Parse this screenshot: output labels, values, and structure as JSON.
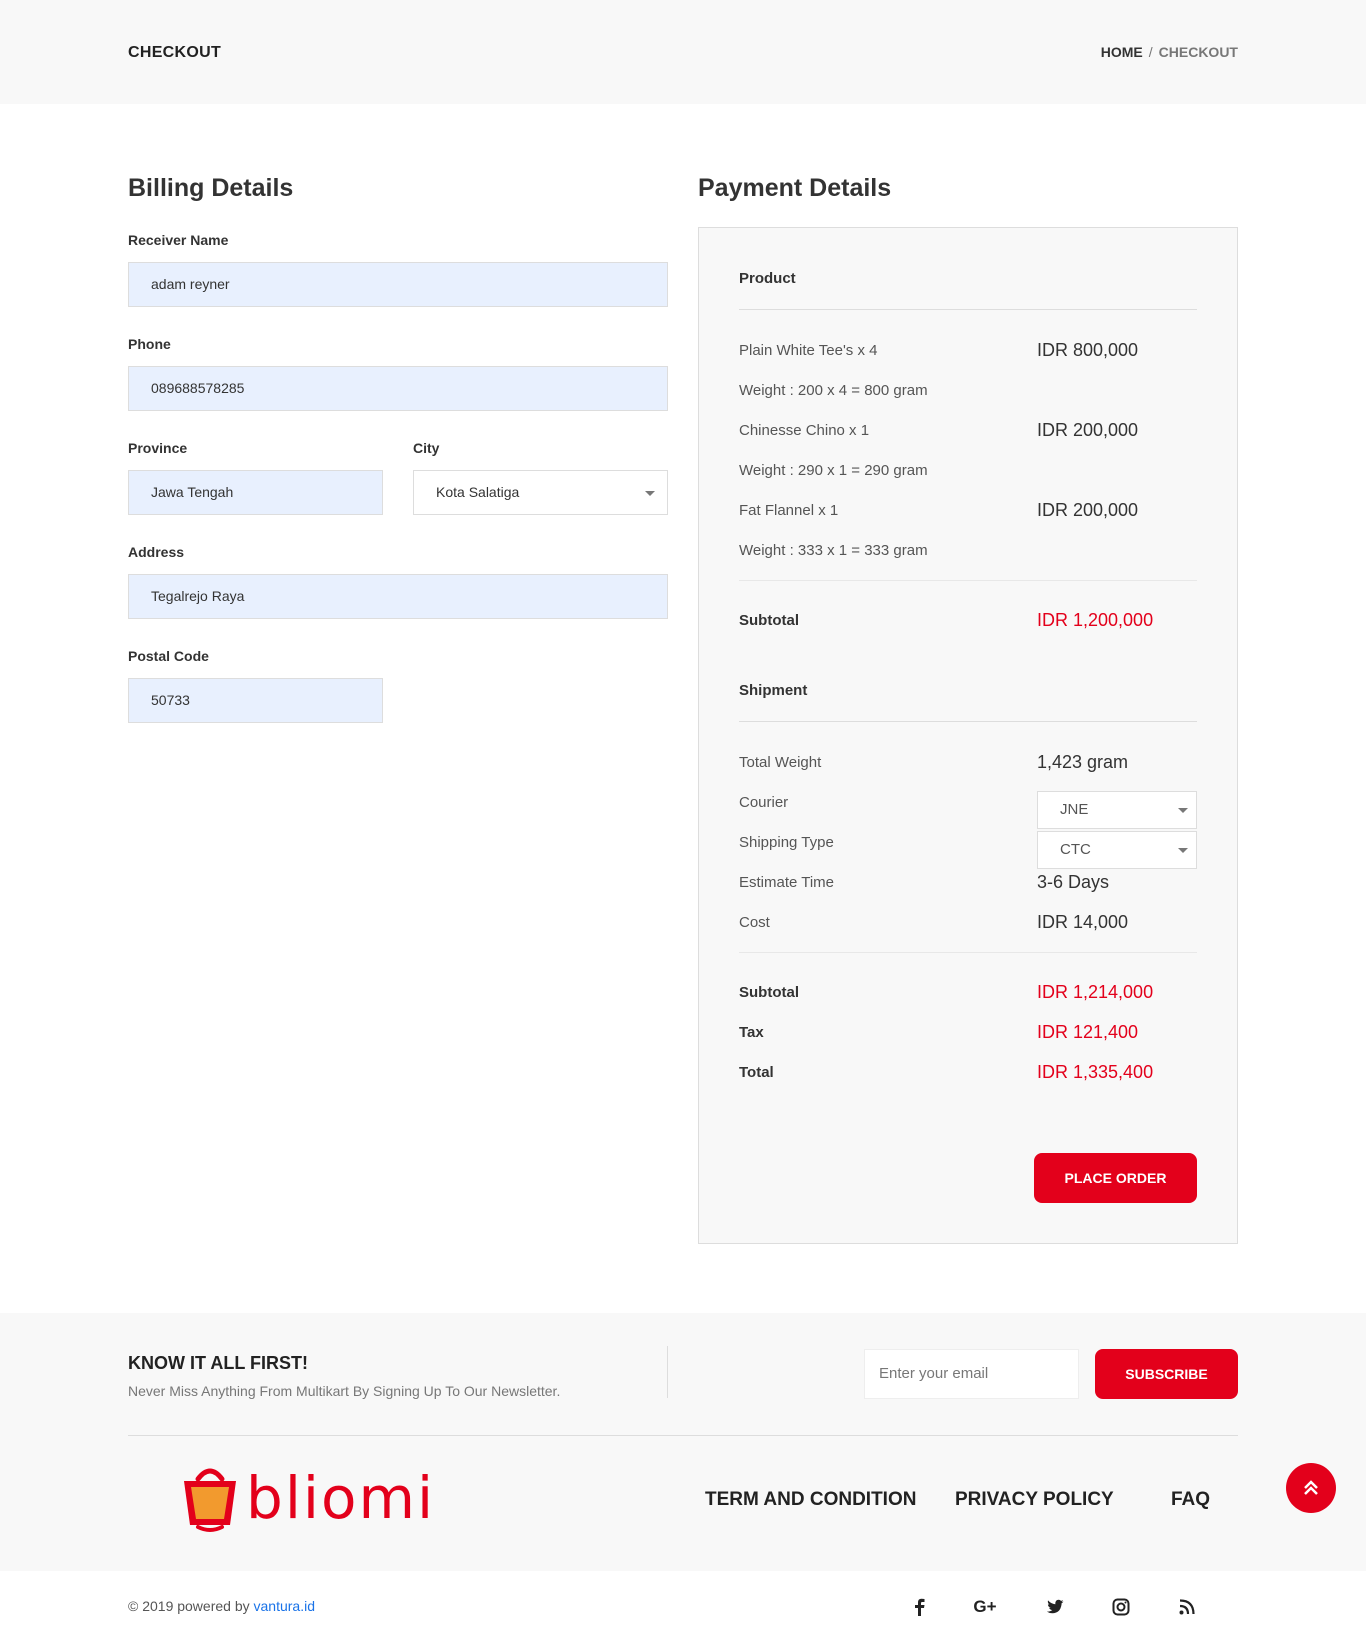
{
  "header": {
    "title": "CHECKOUT",
    "breadcrumb": {
      "home": "HOME",
      "separator": "/",
      "current": "CHECKOUT"
    }
  },
  "billing": {
    "title": "Billing Details",
    "receiver_label": "Receiver Name",
    "receiver_value": "adam reyner",
    "phone_label": "Phone",
    "phone_value": "089688578285",
    "province_label": "Province",
    "province_value": "Jawa Tengah",
    "city_label": "City",
    "city_value": "Kota Salatiga",
    "address_label": "Address",
    "address_value": "Tegalrejo Raya",
    "postal_label": "Postal Code",
    "postal_value": "50733"
  },
  "payment": {
    "title": "Payment Details",
    "product_head": "Product",
    "items": [
      {
        "name": "Plain White Tee's x 4",
        "price": "IDR 800,000",
        "weight": "Weight : 200 x 4 = 800 gram"
      },
      {
        "name": "Chinesse Chino x 1",
        "price": "IDR 200,000",
        "weight": "Weight : 290 x 1 = 290 gram"
      },
      {
        "name": "Fat Flannel x 1",
        "price": "IDR 200,000",
        "weight": "Weight : 333 x 1 = 333 gram"
      }
    ],
    "subtotal_label": "Subtotal",
    "subtotal_value": "IDR 1,200,000",
    "shipment_head": "Shipment",
    "total_weight_label": "Total Weight",
    "total_weight_value": "1,423 gram",
    "courier_label": "Courier",
    "courier_value": "JNE",
    "shipping_type_label": "Shipping Type",
    "shipping_type_value": "CTC",
    "estimate_label": "Estimate Time",
    "estimate_value": "3-6 Days",
    "cost_label": "Cost",
    "cost_value": "IDR 14,000",
    "subtotal2_label": "Subtotal",
    "subtotal2_value": "IDR 1,214,000",
    "tax_label": "Tax",
    "tax_value": "IDR 121,400",
    "total_label": "Total",
    "total_value": "IDR 1,335,400",
    "place_order": "PLACE ORDER"
  },
  "footer": {
    "newsletter_title": "KNOW IT ALL FIRST!",
    "newsletter_sub": "Never Miss Anything From Multikart By Signing Up To Our Newsletter.",
    "email_placeholder": "Enter your email",
    "subscribe": "SUBSCRIBE",
    "logo_text": "bliomi",
    "links": [
      "TERM AND CONDITION",
      "PRIVACY POLICY",
      "FAQ"
    ],
    "copyright_prefix": "© 2019 powered by ",
    "copyright_link": "vantura.id",
    "social": [
      "facebook-icon",
      "google-plus-icon",
      "twitter-icon",
      "instagram-icon",
      "rss-icon"
    ]
  },
  "colors": {
    "accent": "#e3001b",
    "input_bg": "#e8f0fe",
    "panel_bg": "#f8f8f8"
  }
}
